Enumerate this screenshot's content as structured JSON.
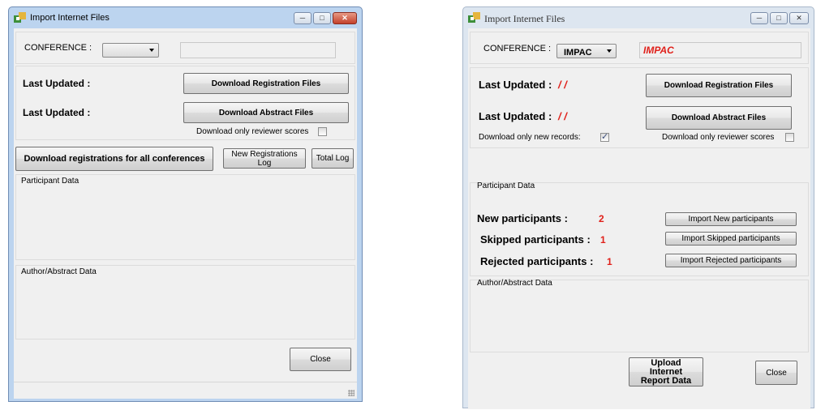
{
  "left_window": {
    "title": "Import Internet Files",
    "conference_label": "CONFERENCE :",
    "conference_value": "",
    "conference_text": "",
    "last_updated_1": "Last Updated :",
    "last_updated_2": "Last Updated :",
    "download_registration": "Download Registration Files",
    "download_abstract": "Download Abstract Files",
    "reviewer_scores_label": "Download only reviewer scores",
    "download_all": "Download registrations for all conferences",
    "new_reg_log": "New Registrations Log",
    "total_log": "Total Log",
    "participant_data": "Participant Data",
    "author_abstract_data": "Author/Abstract Data",
    "close": "Close"
  },
  "right_window": {
    "title": "Import Internet Files",
    "conference_label": "CONFERENCE :",
    "conference_value": "IMPAC",
    "conference_text": "IMPAC",
    "last_updated_1": "Last Updated :",
    "last_updated_1_value": "/ /",
    "last_updated_2": "Last Updated :",
    "last_updated_2_value": "/ /",
    "download_registration": "Download Registration Files",
    "download_abstract": "Download Abstract Files",
    "new_records_label": "Download only new records:",
    "new_records_checked": true,
    "reviewer_scores_label": "Download only reviewer scores",
    "reviewer_scores_checked": false,
    "participant_data": "Participant Data",
    "new_participants_label": "New participants :",
    "new_participants_count": "2",
    "skipped_participants_label": "Skipped participants :",
    "skipped_participants_count": "1",
    "rejected_participants_label": "Rejected participants :",
    "rejected_participants_count": "1",
    "import_new": "Import New participants",
    "import_skipped": "Import Skipped participants",
    "import_rejected": "Import Rejected participants",
    "author_abstract_data": "Author/Abstract Data",
    "upload_report": "Upload Internet Report Data",
    "close": "Close"
  },
  "colors": {
    "accent_red": "#e0201a",
    "left_frame": "#bcd4ef",
    "right_frame": "#dde6f0"
  }
}
